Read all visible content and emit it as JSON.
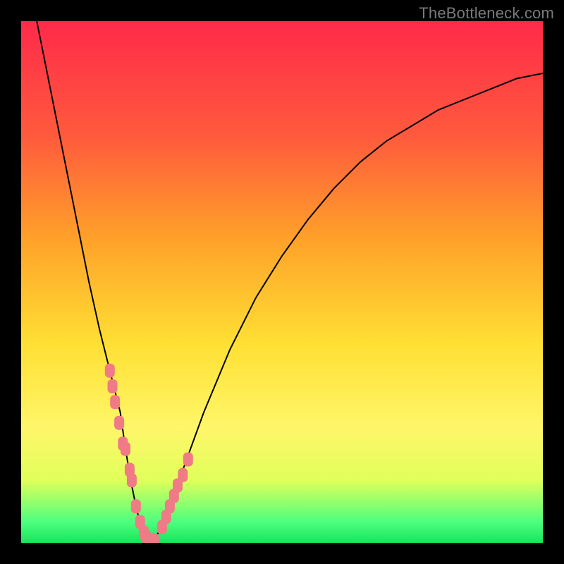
{
  "watermark": "TheBottleneck.com",
  "chart_data": {
    "type": "line",
    "title": "",
    "xlabel": "",
    "ylabel": "",
    "xlim": [
      0,
      100
    ],
    "ylim": [
      0,
      100
    ],
    "series": [
      {
        "name": "bottleneck-curve",
        "x": [
          3,
          5,
          7,
          9,
          11,
          13,
          15,
          17,
          19,
          20,
          21,
          22,
          23,
          24,
          25,
          27,
          29,
          31,
          35,
          40,
          45,
          50,
          55,
          60,
          65,
          70,
          75,
          80,
          85,
          90,
          95,
          100
        ],
        "y": [
          100,
          90,
          80,
          70,
          60,
          50,
          41,
          33,
          25,
          18,
          12,
          7,
          3,
          1,
          0,
          3,
          8,
          14,
          25,
          37,
          47,
          55,
          62,
          68,
          73,
          77,
          80,
          83,
          85,
          87,
          89,
          90
        ]
      }
    ],
    "markers": {
      "name": "highlighted-points",
      "x": [
        17.0,
        17.5,
        18.0,
        18.8,
        19.5,
        20.0,
        20.8,
        21.2,
        22.0,
        22.8,
        23.5,
        24.0,
        24.8,
        25.5,
        27.0,
        27.8,
        28.5,
        29.3,
        30.0,
        31.0,
        32.0
      ],
      "y": [
        33,
        30,
        27,
        23,
        19,
        18,
        14,
        12,
        7,
        4,
        2,
        1,
        0,
        0.5,
        3,
        5,
        7,
        9,
        11,
        13,
        16
      ]
    },
    "gradient_background": {
      "top_color": "#ff2a4a",
      "bottom_color": "#18e55a"
    }
  }
}
